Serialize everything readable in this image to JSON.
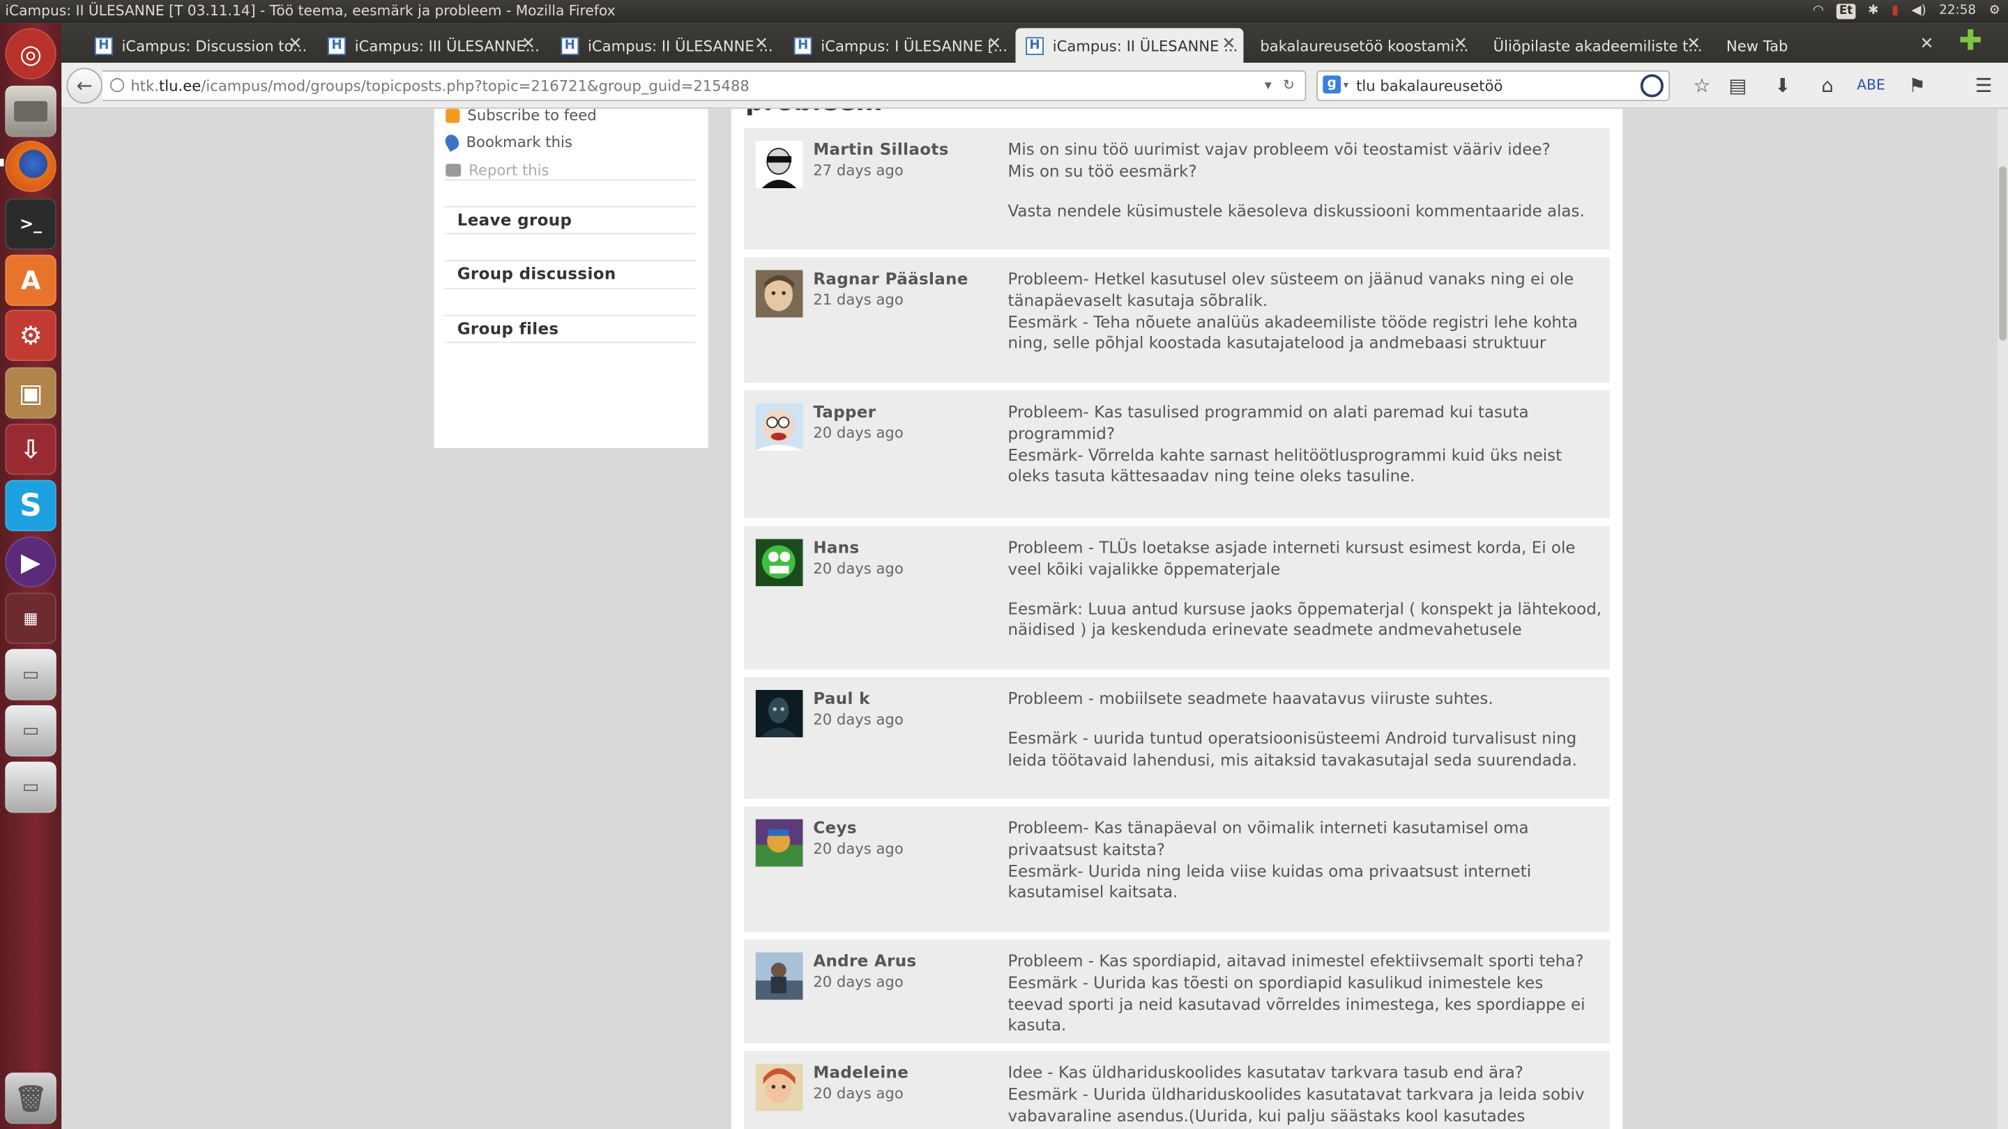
{
  "os": {
    "window_title": "iCampus: II ÜLESANNE [T 03.11.14] - Töö teema, eesmärk ja probleem - Mozilla Firefox",
    "keyboard_layout": "Et",
    "clock": "22:58"
  },
  "browser": {
    "tabs": [
      {
        "label": "iCampus: Discussion to...",
        "favicon": "H"
      },
      {
        "label": "iCampus: III ÜLESANNE...",
        "favicon": "H"
      },
      {
        "label": "iCampus: II ÜLESANNE ...",
        "favicon": "H"
      },
      {
        "label": "iCampus: I ÜLESANNE [...",
        "favicon": "H"
      },
      {
        "label": "iCampus: II ÜLESANNE ...",
        "favicon": "H",
        "active": true
      },
      {
        "label": "bakalaureusetöö koostami...",
        "favicon": ""
      },
      {
        "label": "Üliõpilaste akadeemiliste t...",
        "favicon": ""
      },
      {
        "label": "New Tab",
        "favicon": ""
      }
    ],
    "url_prefix": "htk.",
    "url_host": "tlu.ee",
    "url_path": "/icampus/mod/groups/topicposts.php?topic=216721&group_guid=215488",
    "search_engine": "g",
    "search_value": "tlu bakalaureusetöö"
  },
  "page": {
    "heading_fragment": "probleem",
    "owner_links": {
      "subscribe": "Subscribe to feed",
      "bookmark": "Bookmark this",
      "report": "Report this"
    },
    "menu": {
      "leave": "Leave group",
      "discussion": "Group discussion",
      "files": "Group files"
    },
    "posts": [
      {
        "author": "Martin Sillaots",
        "time": "27 days ago",
        "lines": [
          "Mis on sinu töö uurimist vajav probleem või teostamist vääriv idee?",
          "Mis on su töö eesmärk?",
          "",
          "Vasta nendele küsimustele käesoleva diskussiooni kommentaaride alas."
        ]
      },
      {
        "author": "Ragnar Pääslane",
        "time": "21 days ago",
        "lines": [
          "Probleem- Hetkel kasutusel olev süsteem on jäänud vanaks ning ei ole tänapäevaselt kasutaja sõbralik.",
          "Eesmärk - Teha nõuete analüüs akadeemiliste tööde registri lehe kohta ning, selle põhjal koostada kasutajatelood ja andmebaasi struktuur"
        ]
      },
      {
        "author": "Tapper",
        "time": "20 days ago",
        "lines": [
          "Probleem- Kas tasulised programmid on alati paremad kui tasuta programmid?",
          "Eesmärk- Võrrelda kahte sarnast helitöötlusprogrammi kuid üks neist oleks tasuta kättesaadav ning teine oleks tasuline."
        ]
      },
      {
        "author": "Hans",
        "time": "20 days ago",
        "lines": [
          "Probleem - TLÜs loetakse asjade interneti kursust esimest korda, Ei ole veel kõiki vajalikke õppematerjale",
          "",
          "Eesmärk: Luua antud kursuse jaoks õppematerjal ( konspekt ja lähtekood, näidised ) ja keskenduda erinevate seadmete andmevahetusele"
        ]
      },
      {
        "author": "Paul k",
        "time": "20 days ago",
        "lines": [
          "Probleem - mobiilsete seadmete haavatavus viiruste suhtes.",
          "",
          "Eesmärk - uurida tuntud operatsioonisüsteemi Android turvalisust ning leida töötavaid lahendusi, mis aitaksid tavakasutajal seda suurendada."
        ]
      },
      {
        "author": "Ceys",
        "time": "20 days ago",
        "lines": [
          "Probleem- Kas tänapäeval on võimalik interneti kasutamisel oma privaatsust kaitsta?",
          "Eesmärk- Uurida ning leida viise kuidas oma privaatsust interneti kasutamisel kaitsata."
        ]
      },
      {
        "author": "Andre Arus",
        "time": "20 days ago",
        "lines": [
          "Probleem - Kas spordiapid, aitavad inimestel efektiivsemalt sporti teha?",
          "Eesmärk - Uurida kas tõesti on spordiapid kasulikud inimestele kes teevad sporti ja neid kasutavad võrreldes inimestega, kes spordiappe ei kasuta."
        ]
      },
      {
        "author": "Madeleine",
        "time": "20 days ago",
        "lines": [
          "Idee - Kas üldhariduskoolides kasutatav tarkvara tasub end ära?",
          "Eesmärk - Uurida üldhariduskoolides kasutatavat tarkvara ja leida sobiv vabavaraline asendus.(Uurida, kui palju säästaks kool kasutades vabavara)."
        ]
      }
    ]
  }
}
